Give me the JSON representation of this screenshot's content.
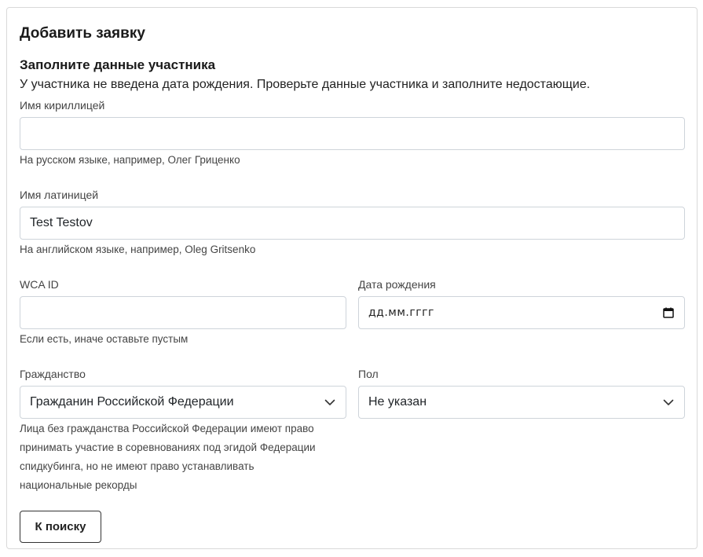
{
  "form": {
    "title": "Добавить заявку",
    "subtitle": "Заполните данные участника",
    "notice": "У участника не введена дата рождения. Проверьте данные участника и заполните недостающие."
  },
  "fields": {
    "name_cyrillic": {
      "label": "Имя кириллицей",
      "value": "",
      "hint": "На русском языке, например, Олег Гриценко"
    },
    "name_latin": {
      "label": "Имя латиницей",
      "value": "Test Testov",
      "hint": "На английском языке, например, Oleg Gritsenko"
    },
    "wca_id": {
      "label": "WCA ID",
      "value": "",
      "hint": "Если есть, иначе оставьте пустым"
    },
    "birth_date": {
      "label": "Дата рождения",
      "placeholder": "дд.мм.гггг",
      "icon": "calendar-icon"
    },
    "citizenship": {
      "label": "Гражданство",
      "selected": "Гражданин Российской Федерации",
      "icon": "chevron-down-icon",
      "hint_lines": [
        "Лица без гражданства Российской Федерации имеют право",
        "принимать участие в соревнованиях под эгидой Федерации",
        "спидкубинга, но не имеют право устанавливать",
        "национальные рекорды"
      ]
    },
    "gender": {
      "label": "Пол",
      "selected": "Не указан",
      "icon": "chevron-down-icon"
    }
  },
  "actions": {
    "back_label": "К поиску"
  },
  "colors": {
    "border": "#ced4da",
    "card_border": "#d9d9d9",
    "text": "#212529",
    "muted": "#444444"
  }
}
